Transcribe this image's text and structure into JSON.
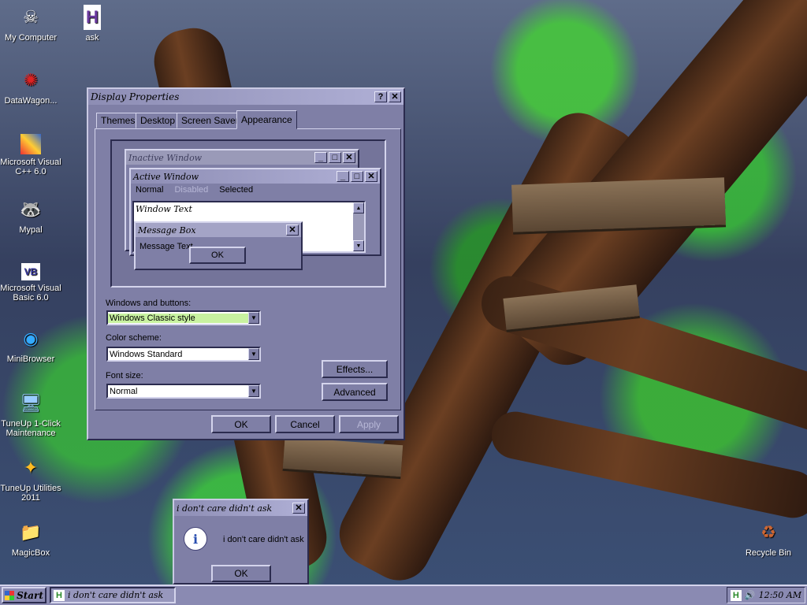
{
  "desktop": {
    "icons": [
      {
        "label": "My Computer",
        "icon": "skull-computer-icon"
      },
      {
        "label": "ask",
        "icon": "h-document-icon"
      },
      {
        "label": "DataWagon...",
        "icon": "red-network-icon"
      },
      {
        "label": "Microsoft Visual C++ 6.0",
        "icon": "visual-cpp-icon"
      },
      {
        "label": "Mypal",
        "icon": "raccoon-icon"
      },
      {
        "label": "Microsoft Visual Basic 6.0",
        "icon": "visual-basic-icon"
      },
      {
        "label": "MiniBrowser",
        "icon": "globe-icon"
      },
      {
        "label": "TuneUp 1-Click Maintenance",
        "icon": "monitor-icon"
      },
      {
        "label": "TuneUp Utilities 2011",
        "icon": "tuneup-icon"
      },
      {
        "label": "MagicBox",
        "icon": "folder-icon"
      },
      {
        "label": "Recycle Bin",
        "icon": "recycle-bin-icon"
      }
    ]
  },
  "display_properties": {
    "title": "Display Properties",
    "help_btn": "?",
    "close_btn": "✕",
    "tabs": [
      "Themes",
      "Desktop",
      "Screen Saver",
      "Appearance"
    ],
    "active_tab": "Appearance",
    "preview": {
      "inactive_title": "Inactive Window",
      "active_title": "Active Window",
      "menu_normal": "Normal",
      "menu_disabled": "Disabled",
      "menu_selected": "Selected",
      "window_text": "Window Text",
      "msgbox_title": "Message Box",
      "msgbox_text": "Message Text",
      "msgbox_ok": "OK"
    },
    "windows_buttons_label": "Windows and buttons:",
    "windows_buttons_value": "Windows Classic style",
    "color_scheme_label": "Color scheme:",
    "color_scheme_value": "Windows Standard",
    "font_size_label": "Font size:",
    "font_size_value": "Normal",
    "effects_btn": "Effects...",
    "advanced_btn": "Advanced",
    "ok_btn": "OK",
    "cancel_btn": "Cancel",
    "apply_btn": "Apply"
  },
  "message_box": {
    "title": "i don't care didn't ask",
    "text": "i don't care didn't ask",
    "ok_btn": "OK",
    "close_btn": "✕",
    "icon": "info-bubble-icon"
  },
  "taskbar": {
    "start_label": "Start",
    "task_label": "i don't care didn't ask",
    "tray_time": "12:50 AM"
  },
  "colors": {
    "window_face": "#7f7fa6",
    "highlight_combo": "#c8f2a0",
    "taskbar": "#8a8ab2"
  }
}
